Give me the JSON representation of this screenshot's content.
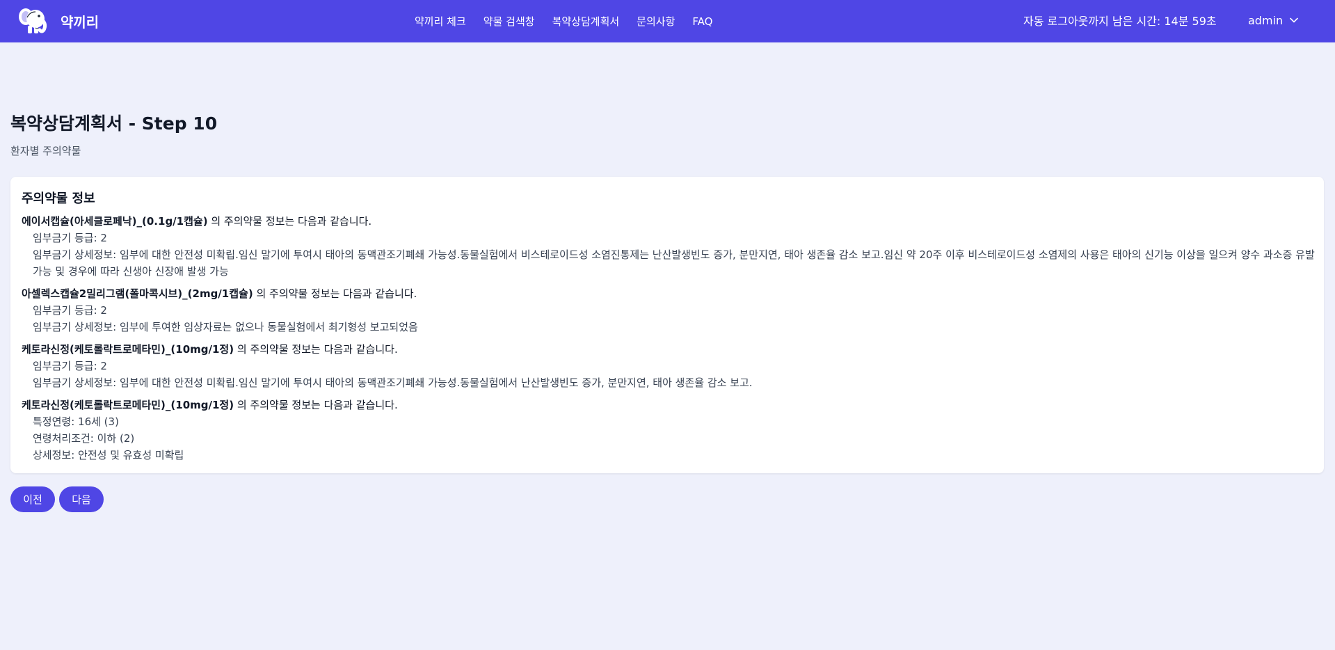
{
  "header": {
    "brand_name": "약끼리",
    "nav": [
      {
        "label": "약끼리 체크"
      },
      {
        "label": "약물 검색창"
      },
      {
        "label": "복약상담계획서"
      },
      {
        "label": "문의사항"
      },
      {
        "label": "FAQ"
      }
    ],
    "timer_text": "자동 로그아웃까지 남은 시간: 14분 59초",
    "user": "admin",
    "accent_color": "#4f46e5"
  },
  "page": {
    "title": "복약상담계획서 - Step 10",
    "subtitle": "환자별 주의약물"
  },
  "card": {
    "title": "주의약물 정보",
    "suffix": "의 주의약물 정보는 다음과 같습니다.",
    "entries": [
      {
        "drug": "에이서캡슐(아세클로페낙)_(0.1g/1캡슐)",
        "details": [
          "임부금기 등급: 2",
          "임부금기 상세정보: 임부에 대한 안전성 미확립.임신 말기에 투여시 태아의 동맥관조기폐쇄 가능성.동물실험에서 비스테로이드성 소염진통제는 난산발생빈도 증가, 분만지연, 태아 생존율 감소 보고.임신 약 20주 이후 비스테로이드성 소염제의 사용은 태아의 신기능 이상을 일으켜 양수 과소증 유발 가능 및 경우에 따라 신생아 신장애 발생 가능"
        ]
      },
      {
        "drug": "아셀렉스캡슐2밀리그램(폴마콕시브)_(2mg/1캡슐)",
        "details": [
          "임부금기 등급: 2",
          "임부금기 상세정보: 임부에 투여한 임상자료는 없으나 동물실험에서 최기형성 보고되었음"
        ]
      },
      {
        "drug": "케토라신정(케토롤락트로메타민)_(10mg/1정)",
        "details": [
          "임부금기 등급: 2",
          "임부금기 상세정보: 임부에 대한 안전성 미확립.임신 말기에 투여시 태아의 동맥관조기폐쇄 가능성.동물실험에서 난산발생빈도 증가, 분만지연, 태아 생존율 감소 보고."
        ]
      },
      {
        "drug": "케토라신정(케토롤락트로메타민)_(10mg/1정)",
        "details": [
          "특정연령: 16세 (3)",
          "연령처리조건: 이하 (2)",
          "상세정보: 안전성 및 유효성 미확립"
        ]
      }
    ]
  },
  "buttons": {
    "prev_label": "이전",
    "next_label": "다음"
  }
}
